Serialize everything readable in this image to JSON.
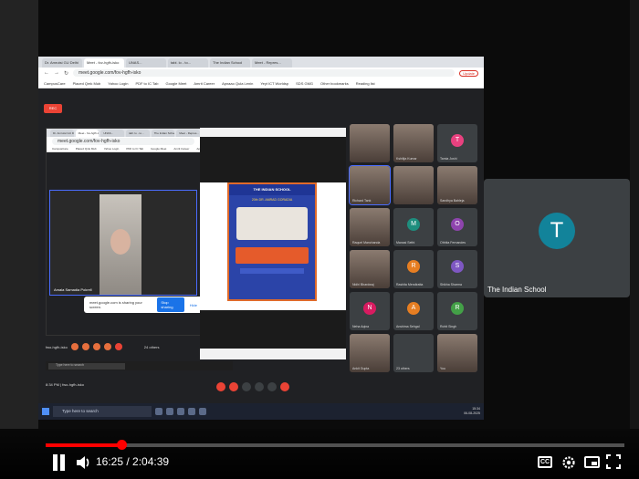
{
  "browser": {
    "tabs": [
      "Dr. Amrutsi GU Delhi",
      "Meet - fov-hgfh-isko",
      "UNAS...",
      "tabl. lo - to...",
      "The Indian School",
      "Meet - Repres..."
    ],
    "url": "meet.google.com/fov-hgfh-isko",
    "update_label": "Update",
    "bookmarks": [
      "CampusCare",
      "Placed Qmk Mub",
      "Yahoo Login",
      "PDF to IC Tab",
      "Google Meet",
      "Amrit Career",
      "Apnaao Qula Lenin",
      "Yeyt ICT Worldsp",
      "SDS GMG",
      "Other bookmarks",
      "Reading list"
    ]
  },
  "recording_badge": "REC",
  "inner": {
    "speaker_name": "Amala Samadia Pokrell"
  },
  "share_toast": {
    "text": "meet.google.com is sharing your screen.",
    "stop_label": "Stop sharing",
    "hide_label": "Hide"
  },
  "poster": {
    "school": "THE INDIAN SCHOOL",
    "headline": "20th DR. AMRAD GORADIA"
  },
  "participants": [
    {
      "name": "",
      "letter": "",
      "color": "#3c4043",
      "photo": true
    },
    {
      "name": "Kshitija Kumar",
      "letter": "",
      "color": "#3c4043",
      "photo": true
    },
    {
      "name": "Tamia Joshi",
      "letter": "T",
      "color": "#e8417f",
      "photo": false
    },
    {
      "name": "Richard Tank",
      "letter": "",
      "color": "#3c4043",
      "photo": true
    },
    {
      "name": "",
      "letter": "",
      "color": "#3c4043",
      "photo": true
    },
    {
      "name": "Sandhya Bahleja",
      "letter": "",
      "color": "#3c4043",
      "photo": true
    },
    {
      "name": "Raquel Manchanda",
      "letter": "",
      "color": "#3c4043",
      "photo": true
    },
    {
      "name": "Manasi Sethi",
      "letter": "M",
      "color": "#1e8e7e",
      "photo": false
    },
    {
      "name": "Ohhita Fernandes",
      "letter": "O",
      "color": "#8e44ad",
      "photo": false
    },
    {
      "name": "Nidhi Bhardwaj",
      "letter": "",
      "color": "#3c4043",
      "photo": true
    },
    {
      "name": "Rashita Mendiratta",
      "letter": "R",
      "color": "#e67e22",
      "photo": false
    },
    {
      "name": "Shikha Sharma",
      "letter": "S",
      "color": "#7e57c2",
      "photo": false
    },
    {
      "name": "Neha Aqina",
      "letter": "N",
      "color": "#d81b60",
      "photo": false
    },
    {
      "name": "Anshima Sehgal",
      "letter": "A",
      "color": "#e67e22",
      "photo": false
    },
    {
      "name": "Rohit Singh",
      "letter": "R",
      "color": "#43a047",
      "photo": false
    },
    {
      "name": "Ankit Gupta",
      "letter": "",
      "color": "#3c4043",
      "photo": true
    },
    {
      "name": "23 others",
      "letter": "",
      "color": "#3c4043",
      "photo": false
    },
    {
      "name": "You",
      "letter": "",
      "color": "#3c4043",
      "photo": true
    }
  ],
  "inner_bar": {
    "meeting_code": "fwo-hgfh-isko",
    "others": "24 others"
  },
  "inner_task": {
    "search": "Type here to search"
  },
  "meet_info": "8:34 PM  |  fwo-hgfh-isko",
  "win_task": {
    "search": "Type here to search",
    "time": "15:34",
    "date": "06-08-2025"
  },
  "big_tile": {
    "letter": "T",
    "name": "The Indian School"
  },
  "player": {
    "current": "16:25",
    "duration": "2:04:39",
    "progress_fraction": 0.131,
    "cc_label": "CC"
  }
}
